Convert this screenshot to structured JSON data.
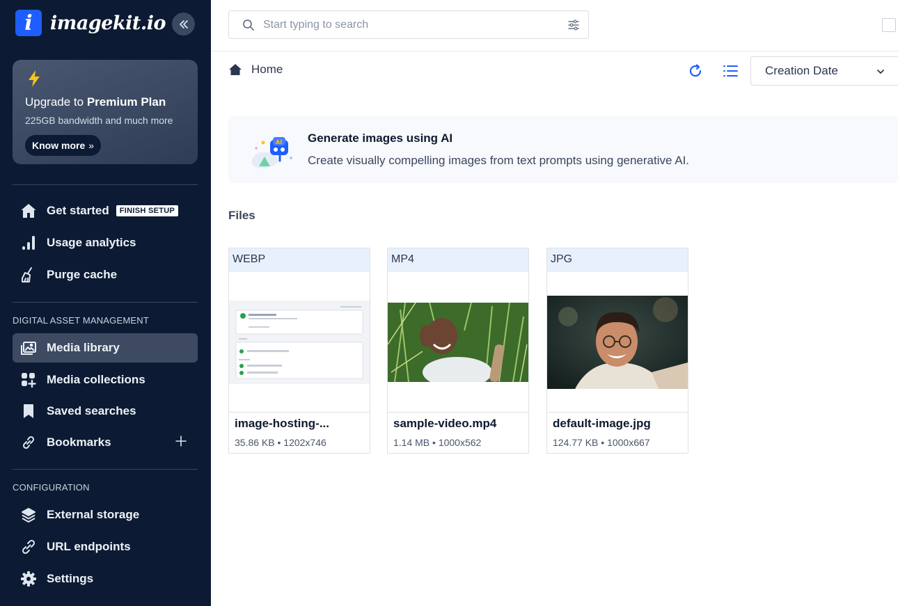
{
  "app": {
    "logo_letter": "i",
    "logo_text": "imagekit.io"
  },
  "promo": {
    "title_prefix": "Upgrade to ",
    "title_bold": "Premium Plan",
    "subtitle": "225GB bandwidth and much more",
    "button_label": "Know more",
    "button_glyph": "»",
    "bolt_color": "#f5c518"
  },
  "nav": {
    "get_started": "Get started",
    "finish_setup_badge": "FINISH SETUP",
    "usage_analytics": "Usage analytics",
    "purge_cache": "Purge cache",
    "dam_section": "DIGITAL ASSET MANAGEMENT",
    "media_library": "Media library",
    "media_collections": "Media collections",
    "saved_searches": "Saved searches",
    "bookmarks": "Bookmarks",
    "config_section": "CONFIGURATION",
    "external_storage": "External storage",
    "url_endpoints": "URL endpoints",
    "settings": "Settings"
  },
  "search": {
    "placeholder": "Start typing to search",
    "value": ""
  },
  "toolbar": {
    "breadcrumb_home": "Home",
    "sort_selected": "Creation Date",
    "accent_color": "#1e5eff"
  },
  "ai_banner": {
    "title": "Generate images using AI",
    "description": "Create visually compelling images from text prompts using generative AI."
  },
  "files": {
    "heading": "Files",
    "items": [
      {
        "type": "WEBP",
        "name": "image-hosting-...",
        "meta": "35.86 KB • 1202x746"
      },
      {
        "type": "MP4",
        "name": "sample-video.mp4",
        "meta": "1.14 MB • 1000x562"
      },
      {
        "type": "JPG",
        "name": "default-image.jpg",
        "meta": "124.77 KB • 1000x667"
      }
    ]
  },
  "colors": {
    "sidebar_bg": "#0c1b33",
    "active_item_bg": "#3d4a62",
    "card_header_bg": "#e8f1fb"
  }
}
